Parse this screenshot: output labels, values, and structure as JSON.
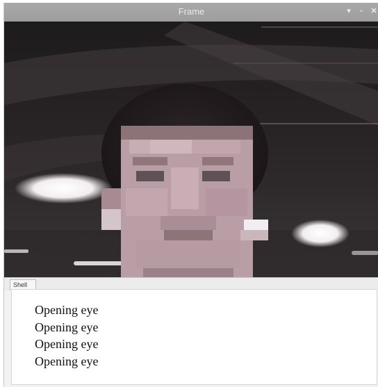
{
  "window": {
    "title": "Frame"
  },
  "controls": {
    "minimize": "▾",
    "maximize": "▫",
    "close": "✕"
  },
  "video": {
    "subject": "camera-frame-with-pixelated-face"
  },
  "shell": {
    "tab_label": "Shell",
    "lines": [
      "Opening eye",
      "Opening eye",
      "Opening eye",
      "Opening eye"
    ]
  }
}
